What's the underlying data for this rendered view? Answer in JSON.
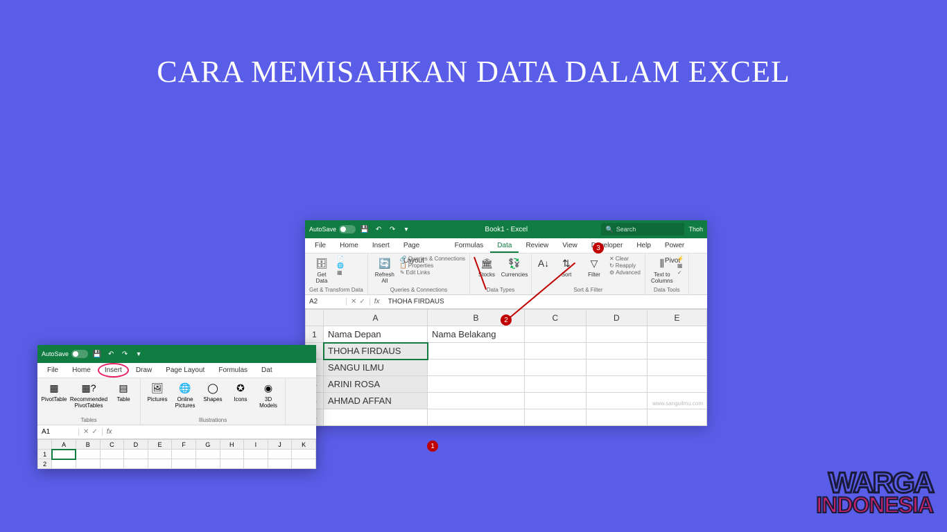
{
  "page_title": "CARA MEMISAHKAN DATA DALAM EXCEL",
  "watermark": {
    "line1": "WARGA",
    "line2": "INDONESIA"
  },
  "annotations": {
    "n1": "1",
    "n2": "2",
    "n3": "3"
  },
  "excel2": {
    "autosave": "AutoSave",
    "win_title": "Book1 - Excel",
    "search_placeholder": "Search",
    "user": "Thoh",
    "tabs": [
      "File",
      "Home",
      "Insert",
      "Page Layout",
      "Formulas",
      "Data",
      "Review",
      "View",
      "Developer",
      "Help",
      "Power Pivot"
    ],
    "active_tab": "Data",
    "ribbon_groups": {
      "g1": {
        "label": "Get & Transform Data",
        "btn": "Get\nData"
      },
      "g2": {
        "label": "Queries & Connections",
        "btn": "Refresh\nAll",
        "r1": "Queries & Connections",
        "r2": "Properties",
        "r3": "Edit Links"
      },
      "g3": {
        "label": "Data Types",
        "b1": "Stocks",
        "b2": "Currencies"
      },
      "g4": {
        "label": "Sort & Filter",
        "b1": "Sort",
        "b2": "Filter",
        "r1": "Clear",
        "r2": "Reapply",
        "r3": "Advanced"
      },
      "g5": {
        "label": "Data Tools",
        "btn": "Text to\nColumns"
      }
    },
    "namebox": "A2",
    "formula": "THOHA FIRDAUS",
    "fx": "fx",
    "columns": [
      "A",
      "B",
      "C",
      "D",
      "E"
    ],
    "rows": [
      {
        "n": "1",
        "A": "Nama Depan",
        "B": "Nama Belakang"
      },
      {
        "n": "2",
        "A": "THOHA FIRDAUS",
        "B": ""
      },
      {
        "n": "3",
        "A": "SANGU ILMU",
        "B": ""
      },
      {
        "n": "4",
        "A": "ARINI ROSA",
        "B": ""
      },
      {
        "n": "5",
        "A": "AHMAD AFFAN",
        "B": ""
      },
      {
        "n": "6",
        "A": "",
        "B": ""
      }
    ],
    "watermark": "www.sanguilmu.com"
  },
  "excel1": {
    "autosave": "AutoSave",
    "tabs": [
      "File",
      "Home",
      "Insert",
      "Draw",
      "Page Layout",
      "Formulas",
      "Dat"
    ],
    "highlight_tab": "Insert",
    "ribbon_groups": {
      "g1": {
        "label": "Tables",
        "b1": "PivotTable",
        "b2": "Recommended\nPivotTables",
        "b3": "Table"
      },
      "g2": {
        "label": "Illustrations",
        "b1": "Pictures",
        "b2": "Online\nPictures",
        "b3": "Shapes",
        "b4": "Icons",
        "b5": "3D\nModels"
      }
    },
    "namebox": "A1",
    "fx": "fx",
    "columns": [
      "A",
      "B",
      "C",
      "D",
      "E",
      "F",
      "G",
      "H",
      "I",
      "J",
      "K"
    ],
    "rows": [
      "1",
      "2"
    ]
  }
}
